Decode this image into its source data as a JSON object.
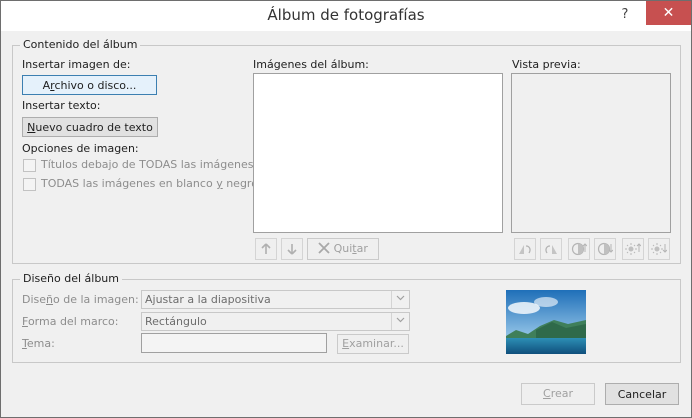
{
  "window": {
    "title": "Álbum de fotografías",
    "help_label": "?",
    "close_label": "✕"
  },
  "contenido": {
    "legend": "Contenido del álbum",
    "insertar_imagen_label": "Insertar imagen de:",
    "archivo_btn": {
      "pre": "A",
      "key": "r",
      "post": "chivo o disco..."
    },
    "insertar_texto_label": "Insertar texto:",
    "cuadro_btn": {
      "key": "N",
      "post": "uevo cuadro de texto"
    },
    "opciones_label": "Opciones de imagen:",
    "titulos_chk": "Títulos debajo de TODAS las imágenes",
    "bn_chk": {
      "pre": "TODAS las imágenes en blanco ",
      "key": "y",
      "post": " negro"
    },
    "imagenes_label": "Imágenes del álbum:",
    "vista_label": "Vista previa:",
    "quitar_btn": {
      "pre": "Qui",
      "key": "t",
      "post": "ar"
    }
  },
  "diseno": {
    "legend": "Diseño del álbum",
    "diseno_imagen_label": {
      "pre": "Dise",
      "key": "ñ",
      "post": "o de la imagen:"
    },
    "diseno_imagen_value": "Ajustar a la diapositiva",
    "forma_label": {
      "key": "F",
      "post": "orma del marco:"
    },
    "forma_value": "Rectángulo",
    "tema_label": {
      "key": "T",
      "post": "ema:"
    },
    "tema_value": "",
    "examinar_btn": {
      "key": "E",
      "post": "xaminar..."
    }
  },
  "footer": {
    "crear_btn": {
      "key": "C",
      "post": "rear"
    },
    "cancelar_btn": "Cancelar"
  },
  "icons": [
    "up-arrow-icon",
    "down-arrow-icon",
    "remove-x-icon",
    "rotate-left-icon",
    "rotate-right-icon",
    "contrast-up-icon",
    "contrast-down-icon",
    "brightness-up-icon",
    "brightness-down-icon",
    "chevron-down-icon"
  ],
  "colors": {
    "close_button": "#c75050",
    "focus_border": "#3c7fb1",
    "dialog_bg": "#f0f0f0"
  }
}
